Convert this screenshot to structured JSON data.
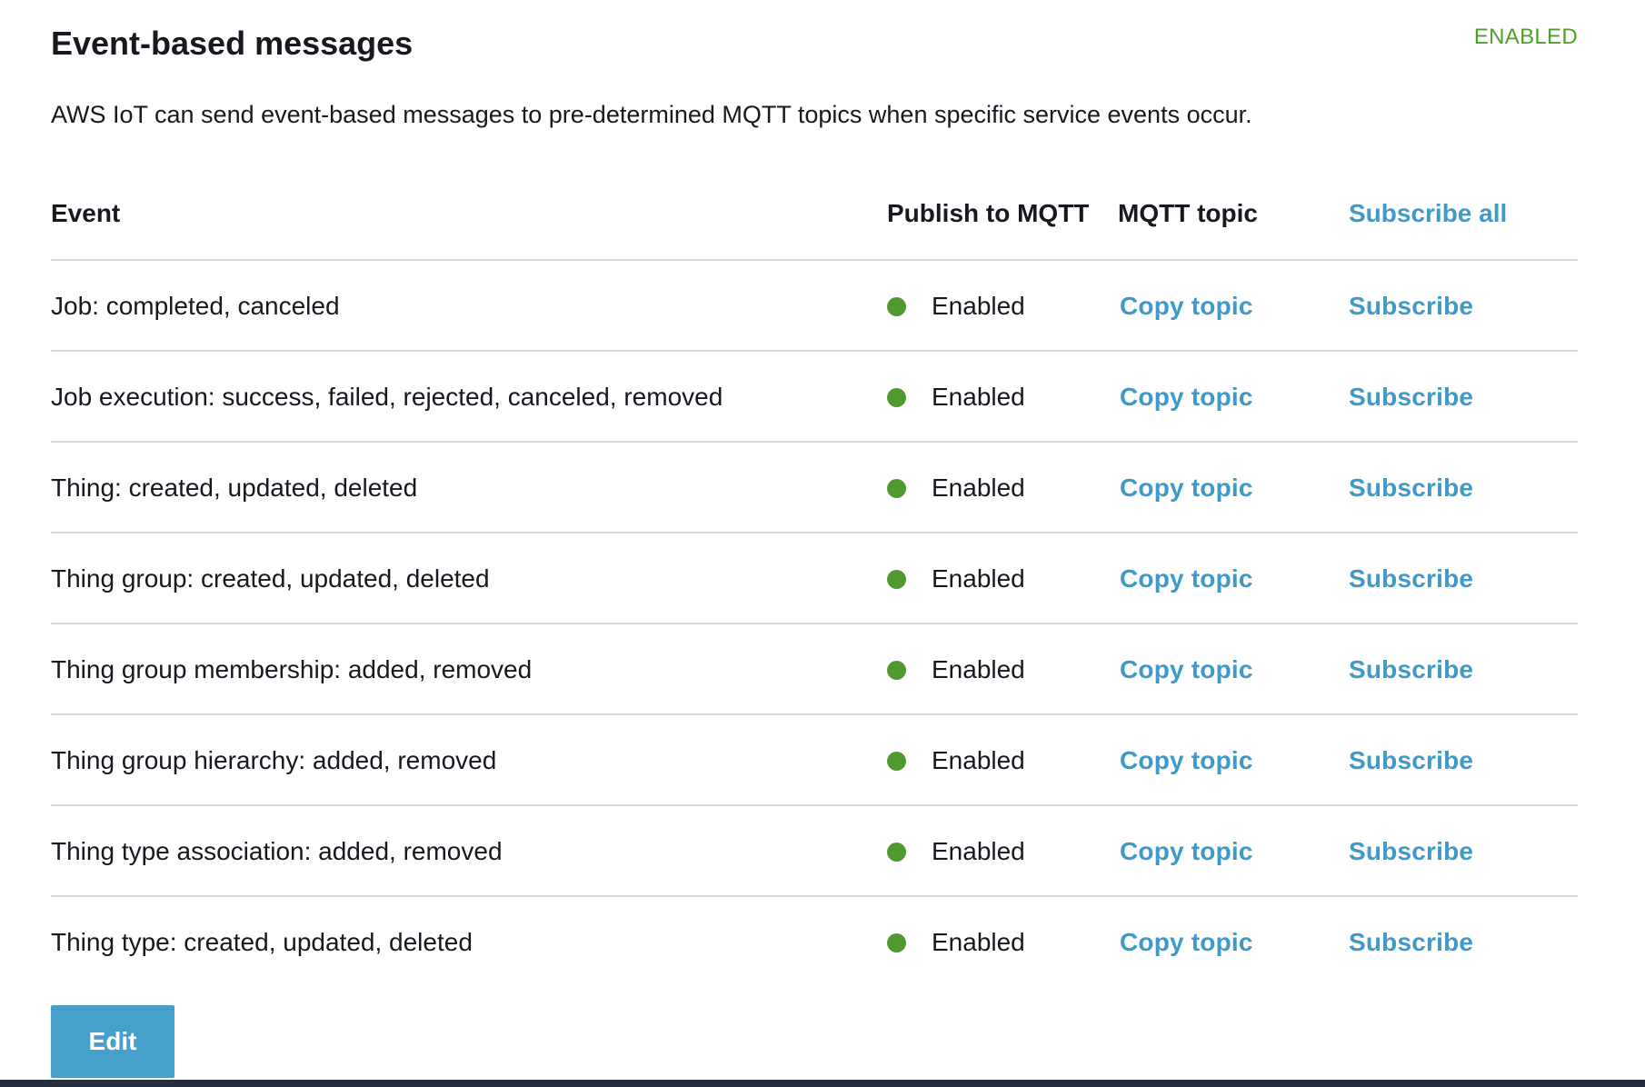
{
  "panel": {
    "title": "Event-based messages",
    "status": "ENABLED",
    "description": "AWS IoT can send event-based messages to pre-determined MQTT topics when specific service events occur."
  },
  "table": {
    "headers": {
      "event": "Event",
      "publish": "Publish to MQTT",
      "topic": "MQTT topic",
      "subscribe_all": "Subscribe all"
    },
    "rows": [
      {
        "event": "Job: completed, canceled",
        "publish": "Enabled",
        "copy": "Copy topic",
        "subscribe": "Subscribe"
      },
      {
        "event": "Job execution: success, failed, rejected, canceled, removed",
        "publish": "Enabled",
        "copy": "Copy topic",
        "subscribe": "Subscribe"
      },
      {
        "event": "Thing: created, updated, deleted",
        "publish": "Enabled",
        "copy": "Copy topic",
        "subscribe": "Subscribe"
      },
      {
        "event": "Thing group: created, updated, deleted",
        "publish": "Enabled",
        "copy": "Copy topic",
        "subscribe": "Subscribe"
      },
      {
        "event": "Thing group membership: added, removed",
        "publish": "Enabled",
        "copy": "Copy topic",
        "subscribe": "Subscribe"
      },
      {
        "event": "Thing group hierarchy: added, removed",
        "publish": "Enabled",
        "copy": "Copy topic",
        "subscribe": "Subscribe"
      },
      {
        "event": "Thing type association: added, removed",
        "publish": "Enabled",
        "copy": "Copy topic",
        "subscribe": "Subscribe"
      },
      {
        "event": "Thing type: created, updated, deleted",
        "publish": "Enabled",
        "copy": "Copy topic",
        "subscribe": "Subscribe"
      }
    ]
  },
  "actions": {
    "edit_label": "Edit"
  },
  "colors": {
    "link": "#3f9ac9",
    "status_green": "#509f2c",
    "enabled_dot": "#4f9a2e",
    "primary_button": "#45a0cc"
  },
  "icons": {
    "status": "status-dot-icon"
  }
}
